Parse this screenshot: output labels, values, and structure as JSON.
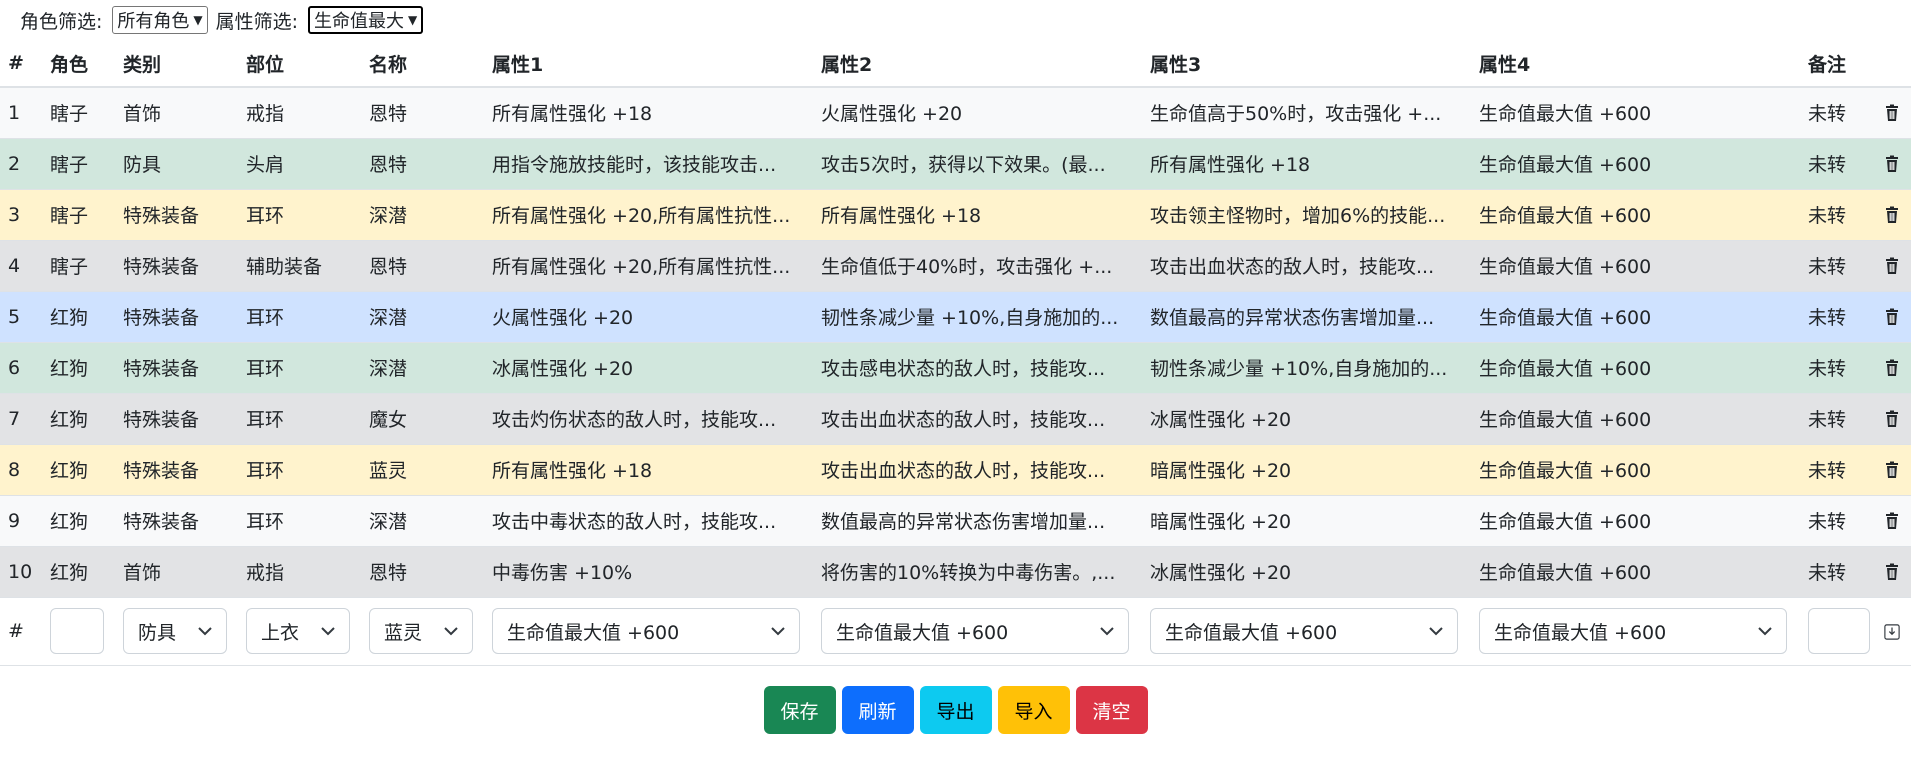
{
  "filters": {
    "role_label": "角色筛选:",
    "role_value": "所有角色",
    "attr_label": "属性筛选:",
    "attr_value": "生命值最大"
  },
  "columns": [
    "#",
    "角色",
    "类别",
    "部位",
    "名称",
    "属性1",
    "属性2",
    "属性3",
    "属性4",
    "备注"
  ],
  "rows": [
    {
      "idx": "1",
      "role": "瞎子",
      "cat": "首饰",
      "slot": "戒指",
      "name": "恩特",
      "a1": "所有属性强化 +18",
      "a2": "火属性强化 +20",
      "a3": "生命值高于50%时，攻击强化 +...",
      "a4": "生命值最大值 +600",
      "note": "未转",
      "color": "c-white"
    },
    {
      "idx": "2",
      "role": "瞎子",
      "cat": "防具",
      "slot": "头肩",
      "name": "恩特",
      "a1": "用指令施放技能时，该技能攻击...",
      "a2": "攻击5次时，获得以下效果。(最...",
      "a3": "所有属性强化 +18",
      "a4": "生命值最大值 +600",
      "note": "未转",
      "color": "c-green"
    },
    {
      "idx": "3",
      "role": "瞎子",
      "cat": "特殊装备",
      "slot": "耳环",
      "name": "深潜",
      "a1": "所有属性强化 +20,所有属性抗性...",
      "a2": "所有属性强化 +18",
      "a3": "攻击领主怪物时，增加6%的技能...",
      "a4": "生命值最大值 +600",
      "note": "未转",
      "color": "c-yellow"
    },
    {
      "idx": "4",
      "role": "瞎子",
      "cat": "特殊装备",
      "slot": "辅助装备",
      "name": "恩特",
      "a1": "所有属性强化 +20,所有属性抗性...",
      "a2": "生命值低于40%时，攻击强化 +...",
      "a3": "攻击出血状态的敌人时，技能攻...",
      "a4": "生命值最大值 +600",
      "note": "未转",
      "color": "c-gray"
    },
    {
      "idx": "5",
      "role": "红狗",
      "cat": "特殊装备",
      "slot": "耳环",
      "name": "深潜",
      "a1": "火属性强化 +20",
      "a2": "韧性条减少量 +10%,自身施加的...",
      "a3": "数值最高的异常状态伤害增加量...",
      "a4": "生命值最大值 +600",
      "note": "未转",
      "color": "c-blue"
    },
    {
      "idx": "6",
      "role": "红狗",
      "cat": "特殊装备",
      "slot": "耳环",
      "name": "深潜",
      "a1": "冰属性强化 +20",
      "a2": "攻击感电状态的敌人时，技能攻...",
      "a3": "韧性条减少量 +10%,自身施加的...",
      "a4": "生命值最大值 +600",
      "note": "未转",
      "color": "c-green"
    },
    {
      "idx": "7",
      "role": "红狗",
      "cat": "特殊装备",
      "slot": "耳环",
      "name": "魔女",
      "a1": "攻击灼伤状态的敌人时，技能攻...",
      "a2": "攻击出血状态的敌人时，技能攻...",
      "a3": "冰属性强化 +20",
      "a4": "生命值最大值 +600",
      "note": "未转",
      "color": "c-gray"
    },
    {
      "idx": "8",
      "role": "红狗",
      "cat": "特殊装备",
      "slot": "耳环",
      "name": "蓝灵",
      "a1": "所有属性强化 +18",
      "a2": "攻击出血状态的敌人时，技能攻...",
      "a3": "暗属性强化 +20",
      "a4": "生命值最大值 +600",
      "note": "未转",
      "color": "c-yellow"
    },
    {
      "idx": "9",
      "role": "红狗",
      "cat": "特殊装备",
      "slot": "耳环",
      "name": "深潜",
      "a1": "攻击中毒状态的敌人时，技能攻...",
      "a2": "数值最高的异常状态伤害增加量...",
      "a3": "暗属性强化 +20",
      "a4": "生命值最大值 +600",
      "note": "未转",
      "color": "c-white"
    },
    {
      "idx": "10",
      "role": "红狗",
      "cat": "首饰",
      "slot": "戒指",
      "name": "恩特",
      "a1": "中毒伤害 +10%",
      "a2": "将伤害的10%转换为中毒伤害。,...",
      "a3": "冰属性强化 +20",
      "a4": "生命值最大值 +600",
      "note": "未转",
      "color": "c-gray"
    }
  ],
  "input_row": {
    "idx": "#",
    "role": "",
    "cat": "防具",
    "slot": "上衣",
    "name": "蓝灵",
    "a1": "生命值最大值 +600",
    "a2": "生命值最大值 +600",
    "a3": "生命值最大值 +600",
    "a4": "生命值最大值 +600",
    "note": ""
  },
  "buttons": {
    "save": "保存",
    "refresh": "刷新",
    "export": "导出",
    "import": "导入",
    "clear": "清空"
  },
  "icons": {
    "delete": "trash-icon",
    "add": "download-icon"
  }
}
